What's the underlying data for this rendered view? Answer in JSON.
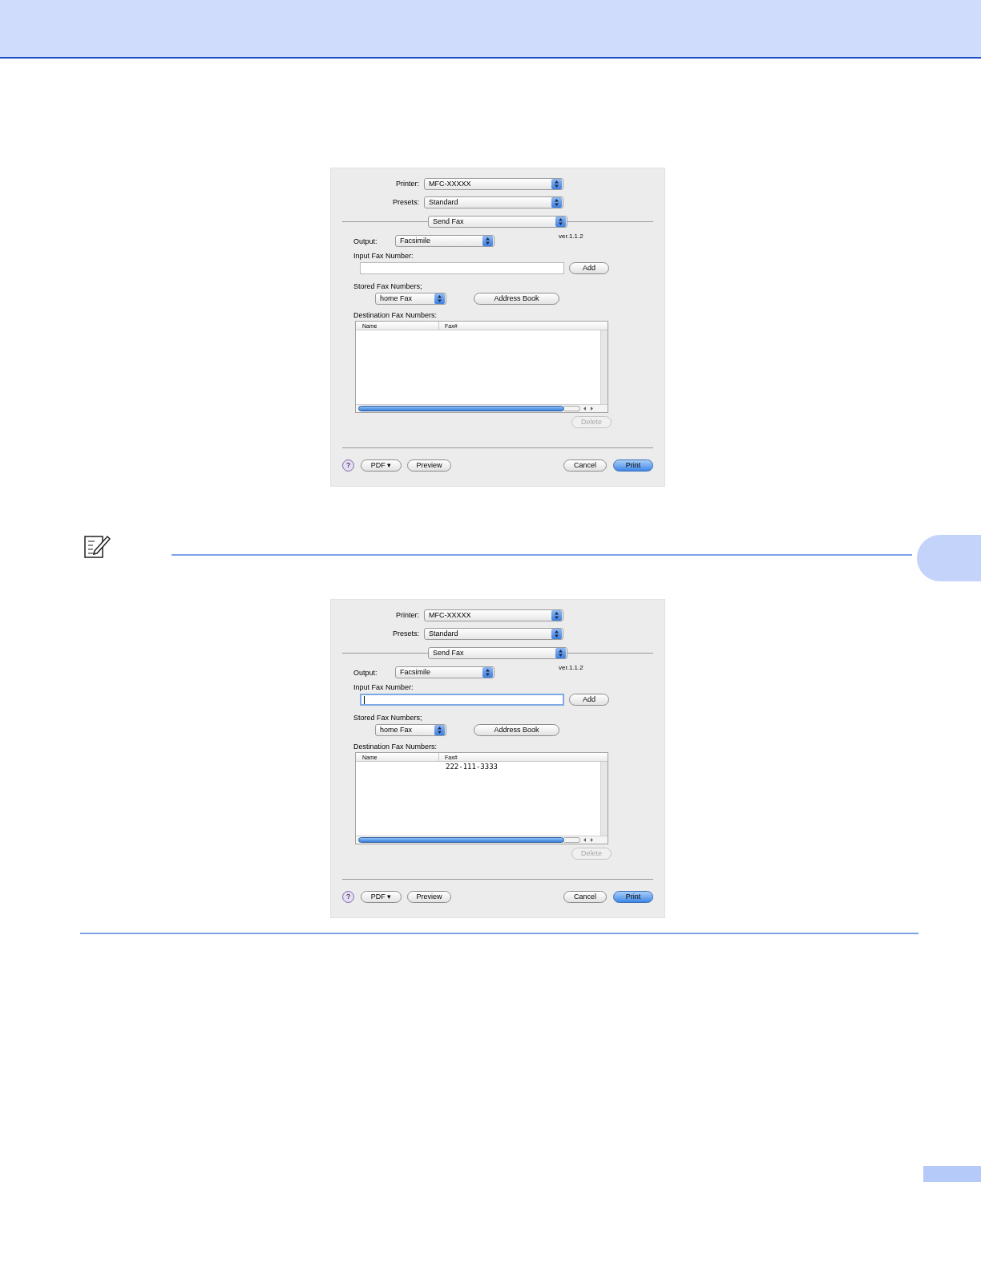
{
  "dialogs": [
    {
      "printer": {
        "label": "Printer:",
        "value": "MFC-XXXXX"
      },
      "presets": {
        "label": "Presets:",
        "value": "Standard"
      },
      "panel": {
        "value": "Send Fax"
      },
      "output": {
        "label": "Output:",
        "value": "Facsimile"
      },
      "version": "ver.1.1.2",
      "input_fax": {
        "label": "Input Fax Number:",
        "focused": false
      },
      "add_button": "Add",
      "stored": {
        "label": "Stored Fax Numbers;",
        "value": "home Fax"
      },
      "address_book_button": "Address Book",
      "destination": {
        "label": "Destination Fax Numbers:",
        "columns": [
          "Name",
          "Fax#"
        ]
      },
      "delete_button": {
        "label": "Delete",
        "disabled": true
      },
      "buttons": {
        "help": "?",
        "pdf": "PDF ▾",
        "preview": "Preview",
        "cancel": "Cancel",
        "print": "Print"
      }
    },
    {
      "printer": {
        "label": "Printer:",
        "value": "MFC-XXXXX"
      },
      "presets": {
        "label": "Presets:",
        "value": "Standard"
      },
      "panel": {
        "value": "Send Fax"
      },
      "output": {
        "label": "Output:",
        "value": "Facsimile"
      },
      "version": "ver.1.1.2",
      "input_fax": {
        "label": "Input Fax Number:",
        "focused": true
      },
      "add_button": "Add",
      "stored": {
        "label": "Stored Fax Numbers;",
        "value": "home Fax"
      },
      "address_book_button": "Address Book",
      "destination": {
        "label": "Destination Fax Numbers:",
        "columns": [
          "Name",
          "Fax#"
        ],
        "rows": [
          {
            "fax": "222-111-3333"
          }
        ]
      },
      "delete_button": {
        "label": "Delete",
        "disabled": true
      },
      "buttons": {
        "help": "?",
        "pdf": "PDF ▾",
        "preview": "Preview",
        "cancel": "Cancel",
        "print": "Print"
      }
    }
  ]
}
